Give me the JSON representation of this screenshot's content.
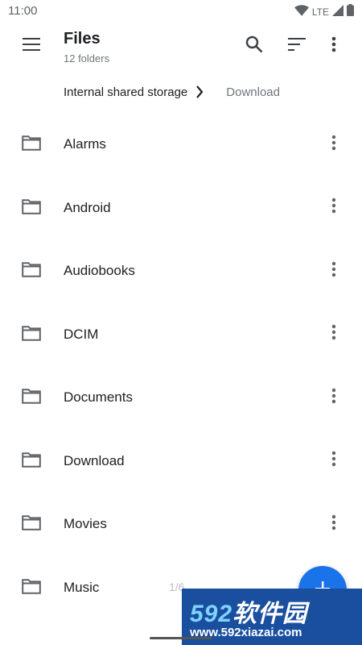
{
  "status_bar": {
    "time": "11:00",
    "network": "LTE",
    "icons": [
      "wifi-icon",
      "cell-signal-icon",
      "battery-icon"
    ]
  },
  "app_bar": {
    "title": "Files",
    "subtitle": "12 folders",
    "icons": [
      "menu-icon",
      "search-icon",
      "sort-icon",
      "more-vert-icon"
    ]
  },
  "breadcrumb": {
    "root": "Internal shared storage",
    "current": "Download"
  },
  "folders": [
    {
      "label": "Alarms"
    },
    {
      "label": "Android"
    },
    {
      "label": "Audiobooks"
    },
    {
      "label": "DCIM"
    },
    {
      "label": "Documents"
    },
    {
      "label": "Download"
    },
    {
      "label": "Movies"
    },
    {
      "label": "Music"
    }
  ],
  "page_indicator": "1/6",
  "fab": {
    "icon": "add-icon"
  },
  "watermark": {
    "logo_number": "592",
    "logo_text": "软件园",
    "url": "www.592xiazai.com"
  },
  "colors": {
    "accent": "#1a73e8",
    "text_primary": "#202124",
    "text_secondary": "#70757a",
    "icon": "#5f6368",
    "watermark_bg": "#1a4fa0"
  }
}
